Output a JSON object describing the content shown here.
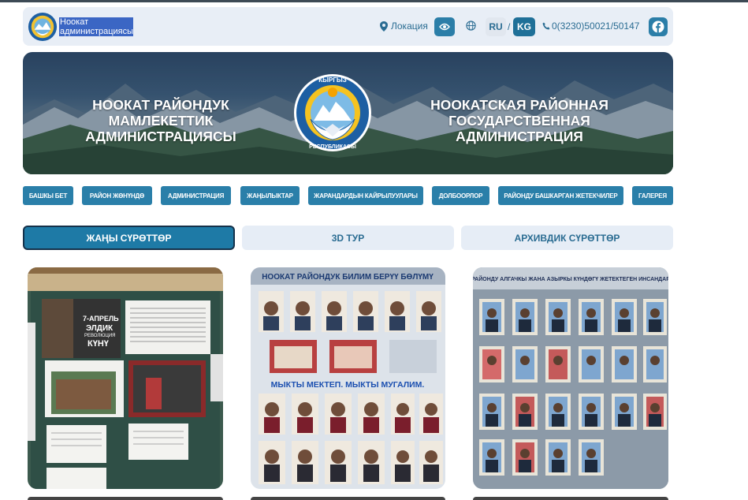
{
  "header": {
    "site_name": "Ноокат администрациясы",
    "location_label": "Локация",
    "lang_ru": "RU",
    "lang_separator": "/",
    "lang_kg": "KG",
    "phone": "0(3230)50021/50147"
  },
  "banner": {
    "title_kg": "НООКАТ РАЙОНДУК МАМЛЕКЕТТИК АДМИНИСТРАЦИЯСЫ",
    "title_ru": "НООКАТСКАЯ РАЙОННАЯ ГОСУДАРСТВЕННАЯ АДМИНИСТРАЦИЯ",
    "emblem_top": "КЫРГЫЗ",
    "emblem_bottom": "РЕСПУБЛИКАСЫ"
  },
  "nav": {
    "items": [
      {
        "label": "БАШКЫ БЕТ"
      },
      {
        "label": "РАЙОН ЖӨНҮНДӨ"
      },
      {
        "label": "АДМИНИСТРАЦИЯ"
      },
      {
        "label": "ЖАҢЫЛЫКТАР"
      },
      {
        "label": "ЖАРАНДАРДЫН КАЙРЫЛУУЛАРЫ"
      },
      {
        "label": "ДОЛБООРЛОР"
      },
      {
        "label": "РАЙОНДУ БАШКАРГАН ЖЕТЕКЧИЛЕР"
      },
      {
        "label": "ГАЛЕРЕЯ"
      }
    ]
  },
  "tabs": [
    {
      "label": "ЖАҢЫ СҮРӨТТӨР",
      "active": true
    },
    {
      "label": "3D ТУР",
      "active": false
    },
    {
      "label": "АРХИВДИК СҮРӨТТӨР",
      "active": false
    }
  ],
  "photos": [
    {
      "poster_line1": "7-АПРЕЛЬ",
      "poster_line2": "ЭЛДИК",
      "poster_line3": "РЕВОЛЮЦИЯ",
      "poster_line4": "КҮНҮ"
    },
    {
      "header_text": "НООКАТ РАЙОНДУК БИЛИМ БЕРҮҮ БӨЛҮМҮ",
      "mid_text": "МЫКТЫ МЕКТЕП. МЫКТЫ МУГАЛИМ."
    },
    {
      "header_text": "РАЙОНДУ  АЛГАЧКЫ ЖАНА АЗЫРКЫ КҮНДӨГҮ ЖЕТЕКТЕГЕН ИНСАНДАР"
    }
  ],
  "colors": {
    "accent": "#2a7fa9",
    "topbar_bg": "#e8eef6",
    "tab_bg": "#e6edf6"
  }
}
